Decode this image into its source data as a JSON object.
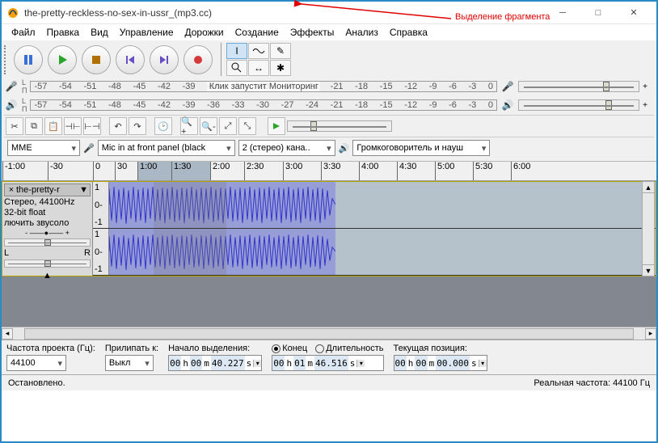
{
  "title": "the-pretty-reckless-no-sex-in-ussr_(mp3.cc)",
  "menu": [
    "Файл",
    "Правка",
    "Вид",
    "Управление",
    "Дорожки",
    "Создание",
    "Эффекты",
    "Анализ",
    "Справка"
  ],
  "annotation": "Выделение фрагмента",
  "meter_ticks": [
    "-57",
    "-54",
    "-51",
    "-48",
    "-45",
    "-42",
    "-39",
    "-36",
    "-33",
    "-30",
    "-27",
    "-24",
    "-21",
    "-18",
    "-15",
    "-12",
    "-9",
    "-6",
    "-3",
    "0"
  ],
  "rec_meter_hint": "Клик запустит Мониторинг",
  "devices": {
    "host": "MME",
    "input": "Mic in at front panel (black",
    "channels": "2 (стерео) кана..",
    "output": "Громкоговоритель и науш"
  },
  "timeline": [
    "-1:00",
    "-30",
    "0",
    "30",
    "1:00",
    "1:30",
    "2:00",
    "2:30",
    "3:00",
    "3:30",
    "4:00",
    "4:30",
    "5:00",
    "5:30",
    "6:00"
  ],
  "track": {
    "name": "the-pretty-r",
    "fmt1": "Стерео, 44100Hz",
    "fmt2": "32-bit float",
    "fmt3": "лючить звусоло",
    "scale": [
      "1",
      "0-",
      "-1"
    ]
  },
  "selbar": {
    "rate_label": "Частота проекта (Гц):",
    "rate_value": "44100",
    "snap_label": "Прилипать к:",
    "snap_value": "Выкл",
    "start_label": "Начало выделения:",
    "end_radio": "Конец",
    "len_radio": "Длительность",
    "pos_label": "Текущая позиция:",
    "start_h": "00",
    "start_m": "00",
    "start_s": "40.227",
    "end_h": "00",
    "end_m": "01",
    "end_s": "46.516",
    "pos_h": "00",
    "pos_m": "00",
    "pos_s": "00.000",
    "hlabel": "h",
    "mlabel": "m",
    "slabel": "s"
  },
  "status": {
    "left": "Остановлено.",
    "right": "Реальная частота: 44100 Гц"
  }
}
